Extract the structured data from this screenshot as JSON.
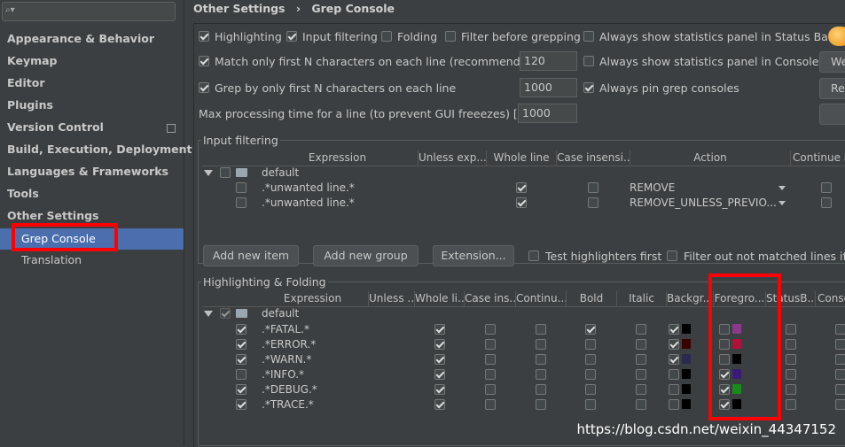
{
  "sidebar": {
    "search_placeholder": "",
    "items": [
      {
        "label": "Appearance & Behavior"
      },
      {
        "label": "Keymap"
      },
      {
        "label": "Editor"
      },
      {
        "label": "Plugins"
      },
      {
        "label": "Version Control"
      },
      {
        "label": "Build, Execution, Deployment"
      },
      {
        "label": "Languages & Frameworks"
      },
      {
        "label": "Tools"
      },
      {
        "label": "Other Settings"
      }
    ],
    "subitems": [
      {
        "label": "Grep Console",
        "selected": true
      },
      {
        "label": "Translation",
        "selected": false
      }
    ]
  },
  "breadcrumb": {
    "parent": "Other Settings",
    "separator": "›",
    "current": "Grep Console"
  },
  "options": {
    "highlighting": "Highlighting",
    "input_filtering": "Input filtering",
    "folding": "Folding",
    "filter_before_grepping": "Filter before grepping",
    "stats_status_bar": "Always show statistics panel in Status Bar",
    "match_first_n": "Match only first N characters on each line (recommended)",
    "match_first_n_value": "120",
    "stats_console": "Always show statistics panel in Console",
    "grep_first_n": "Grep by only first N characters on each line",
    "grep_first_n_value": "1000",
    "pin_grep": "Always pin grep consoles",
    "max_time": "Max processing time for a line (to prevent GUI freeezes) [ms]",
    "max_time_value": "1000",
    "right_btn1": "We",
    "right_btn2": "Re"
  },
  "input_filtering": {
    "title": "Input filtering",
    "columns": [
      "Expression",
      "Unless exp...",
      "Whole line",
      "Case insensi...",
      "Action",
      "Continue m"
    ],
    "group": "default",
    "rows": [
      {
        "expression": ".*unwanted line.*",
        "whole_line": true,
        "action": "REMOVE"
      },
      {
        "expression": ".*unwanted line.*",
        "whole_line": true,
        "action": "REMOVE_UNLESS_PREVIO..."
      }
    ],
    "buttons": [
      "Add new item",
      "Add new group",
      "Extension..."
    ],
    "test_first": "Test highlighters first",
    "filter_out": "Filter out not matched lines if th"
  },
  "highlighting": {
    "title": "Highlighting & Folding",
    "columns": [
      "Expression",
      "Unless ...",
      "Whole li...",
      "Case ins...",
      "Continu...",
      "Bold",
      "Italic",
      "Backgr...",
      "Foregro...",
      "StatusB...",
      "Conso"
    ],
    "group": "default",
    "rows": [
      {
        "expression": ".*FATAL.*",
        "enabled": true,
        "bold": true,
        "bg_on": true,
        "bg": "#000000",
        "fg_on": false,
        "fg": "#8b3a8b"
      },
      {
        "expression": ".*ERROR.*",
        "enabled": true,
        "bold": false,
        "bg_on": true,
        "bg": "#3a0000",
        "fg_on": false,
        "fg": "#b0103a"
      },
      {
        "expression": ".*WARN.*",
        "enabled": true,
        "bold": false,
        "bg_on": true,
        "bg": "#2a2a50",
        "fg_on": false,
        "fg": "#000000"
      },
      {
        "expression": ".*INFO.*",
        "enabled": false,
        "bold": false,
        "bg_on": false,
        "bg": "#000000",
        "fg_on": true,
        "fg": "#3a1a78"
      },
      {
        "expression": ".*DEBUG.*",
        "enabled": true,
        "bold": false,
        "bg_on": false,
        "bg": "#000000",
        "fg_on": true,
        "fg": "#1a8a1a"
      },
      {
        "expression": ".*TRACE.*",
        "enabled": true,
        "bold": false,
        "bg_on": false,
        "bg": "#000000",
        "fg_on": true,
        "fg": "#000000"
      }
    ]
  },
  "watermark": "https://blog.csdn.net/weixin_44347152"
}
